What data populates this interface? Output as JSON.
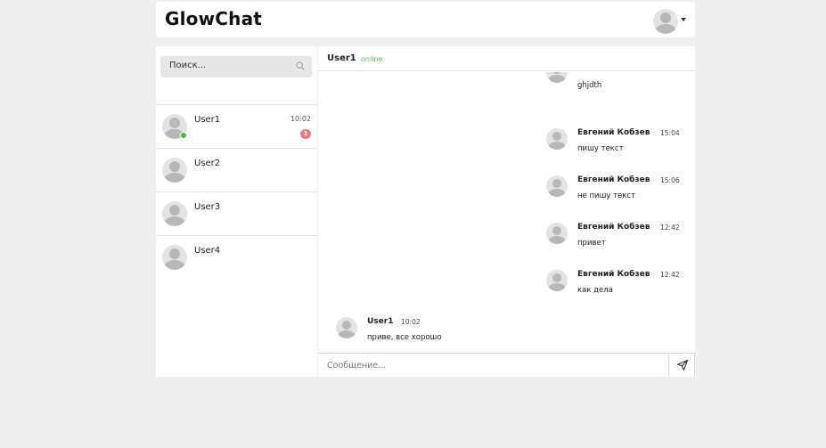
{
  "app": {
    "brand": "GlowChat"
  },
  "search": {
    "placeholder": "Поиск..."
  },
  "contacts": [
    {
      "name": "User1",
      "time": "10:02",
      "unread": "1",
      "online": true
    },
    {
      "name": "User2",
      "time": "",
      "unread": "",
      "online": false
    },
    {
      "name": "User3",
      "time": "",
      "unread": "",
      "online": false
    },
    {
      "name": "User4",
      "time": "",
      "unread": "",
      "online": false
    }
  ],
  "chat": {
    "title": "User1",
    "status": "online",
    "messages": [
      {
        "author": "",
        "time": "",
        "text": "ghjdth"
      },
      {
        "author": "Евгений Кобзев",
        "time": "15:04",
        "text": "пишу текст"
      },
      {
        "author": "Евгений Кобзев",
        "time": "15:06",
        "text": "не пишу текст"
      },
      {
        "author": "Евгений Кобзев",
        "time": "12:42",
        "text": "привет"
      },
      {
        "author": "Евгений Кобзев",
        "time": "12:42",
        "text": "как дела"
      },
      {
        "author": "User1",
        "time": "10:02",
        "text": "приве, все хорошо"
      }
    ]
  },
  "composer": {
    "placeholder": "Сообщение..."
  },
  "colors": {
    "online": "#3cbf3c",
    "badge": "#e97c7c",
    "status_text": "#5cb85c"
  },
  "icons": {
    "search": "search-icon",
    "send": "paper-plane-icon",
    "user_menu": "chevron-down-icon"
  }
}
